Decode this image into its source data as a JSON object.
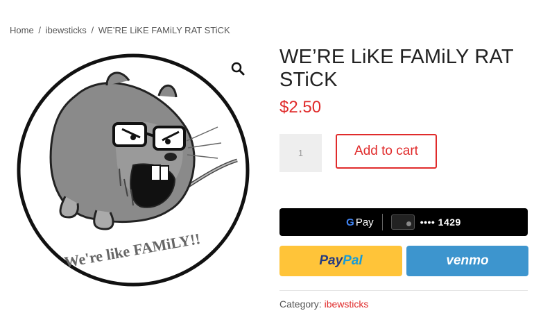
{
  "breadcrumb": {
    "home": "Home",
    "sep1": "/",
    "category": "ibewsticks",
    "sep2": "/",
    "current": "WE’RE LiKE FAMiLY RAT STiCK"
  },
  "product": {
    "title": "WE’RE LiKE FAMiLY RAT STiCK",
    "price": "$2.50",
    "image_caption": "We're like FAMiLY!!",
    "zoom_icon": "search-icon"
  },
  "cart": {
    "quantity": "1",
    "add_label": "Add to cart"
  },
  "payments": {
    "gpay_g": "G",
    "gpay_label": "Pay",
    "card_mask": "•••• 1429",
    "paypal_part1": "Pay",
    "paypal_part2": "Pal",
    "venmo_label": "venmo"
  },
  "meta": {
    "category_label": "Category:",
    "category_value": "ibewsticks"
  },
  "colors": {
    "accent": "#e02b2b",
    "paypal": "#ffc439",
    "venmo": "#3d95ce",
    "gpay": "#000000"
  }
}
